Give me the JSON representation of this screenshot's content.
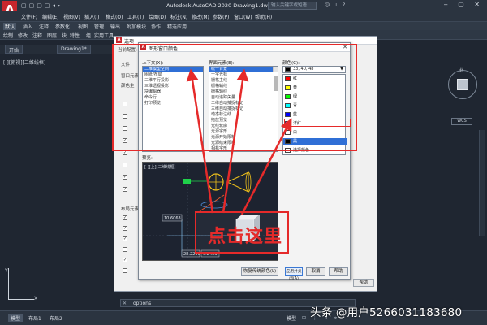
{
  "titlebar": {
    "logo": "A",
    "title": "Autodesk AutoCAD 2020    Drawing1.dwg",
    "search_placeholder": "输入关键字或短语",
    "quick_access": "▢▢▢▢◂▸",
    "user_area": "☺ ⟂ ?",
    "window_buttons": "‒ ▢ ✕"
  },
  "menubar": {
    "items": [
      "文件(F)",
      "编辑(E)",
      "视图(V)",
      "插入(I)",
      "格式(O)",
      "工具(T)",
      "绘图(D)",
      "标注(N)",
      "修改(M)",
      "参数(P)",
      "窗口(W)",
      "帮助(H)"
    ]
  },
  "ribbon": {
    "tabs": [
      "默认",
      "插入",
      "注释",
      "参数化",
      "视图",
      "管理",
      "输出",
      "附加模块",
      "协作",
      "精选应用"
    ],
    "row": [
      "绘制",
      "修改",
      "注释",
      "图层",
      "块",
      "特性",
      "组",
      "实用工具"
    ]
  },
  "file_tabs": [
    "开始",
    "Drawing1*"
  ],
  "viewport_label": "[-][俯视][二维线框]",
  "viewcube": {
    "label": "北",
    "wcs": "WCS"
  },
  "ucs": {
    "x": "X",
    "y": "Y"
  },
  "command_line": {
    "text": "_options",
    "close": "✕"
  },
  "status_tabs": [
    "模型",
    "布局1",
    "布局2"
  ],
  "status_model": "模型",
  "status_icons": "⊞ ⋮ ⊿ ⌖",
  "watermark": "头条 @用户5266031183680",
  "options_dialog": {
    "title": "选项",
    "current_config": "当前配置:",
    "tabs_hint": "文件",
    "sections": [
      "窗口元素",
      "颜色主",
      "布局元素"
    ],
    "help_label": "帮助"
  },
  "color_dialog": {
    "title": "图形窗口颜色",
    "context_label": "上下文(X):",
    "interface_label": "界面元素(E):",
    "color_label": "颜色(C):",
    "contexts": [
      "二维模型空间",
      "图纸/布局",
      "三维平行投影",
      "三维透视投影",
      "块编辑器",
      "命令行",
      "打印预览"
    ],
    "context_selected_index": 0,
    "elements": [
      "统一背景",
      "十字光标",
      "栅格主线",
      "栅格辅线",
      "栅格轴线",
      "自动追踪矢量",
      "二维自动捕捉标记",
      "三维自动捕捉标记",
      "动态标注线",
      "拖放预览",
      "光线轮廓",
      "光源字形",
      "光源开始限制",
      "光源结束限制",
      "相机字形",
      "相机视野/平截面"
    ],
    "element_selected_index": 0,
    "color_value": "33, 40, 48",
    "color_options": [
      {
        "name": "红",
        "hex": "#ff0000"
      },
      {
        "name": "黄",
        "hex": "#ffff00"
      },
      {
        "name": "绿",
        "hex": "#00ff00"
      },
      {
        "name": "青",
        "hex": "#00ffff"
      },
      {
        "name": "蓝",
        "hex": "#0000ff"
      },
      {
        "name": "洋红",
        "hex": "#ff00ff"
      },
      {
        "name": "白",
        "hex": "#ffffff"
      },
      {
        "name": "黑",
        "hex": "#000000"
      },
      {
        "name": "选择颜色...",
        "hex": "#ffffff"
      }
    ],
    "color_selected_index": 7,
    "preview_label": "预览:",
    "preview_tag": "[-][上][二维线框]",
    "preview_coords": [
      "10.6063",
      "28.2290",
      "6.2453"
    ],
    "buttons": [
      "恢复传统颜色(L)",
      "应用并关闭(A)",
      "取消",
      "帮助"
    ]
  },
  "annotation": {
    "callout_text": "点击这里",
    "color": "#e52a2a"
  }
}
